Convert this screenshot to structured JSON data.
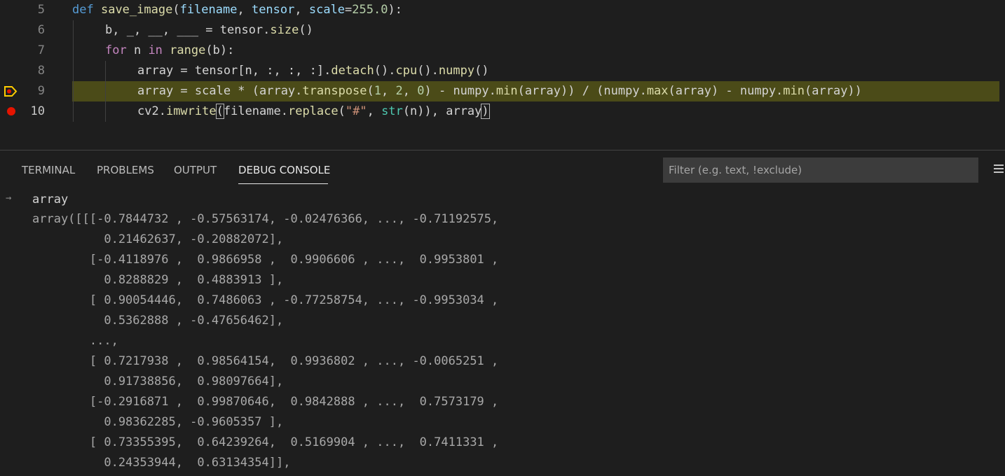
{
  "editor": {
    "lines": [
      {
        "number": "5"
      },
      {
        "number": "6"
      },
      {
        "number": "7"
      },
      {
        "number": "8"
      },
      {
        "number": "9"
      },
      {
        "number": "10"
      }
    ],
    "code": {
      "l5_def": "def",
      "l5_fn": "save_image",
      "l5_p1": "filename",
      "l5_p2": "tensor",
      "l5_p3": "scale",
      "l5_num": "255.0",
      "l6_text": "b, _, __, ___ = tensor.",
      "l6_fn": "size",
      "l7_for": "for",
      "l7_n": " n ",
      "l7_in": "in",
      "l7_range": "range",
      "l7_rest": "(b):",
      "l8_a": "array = tensor[n, :, :, :].",
      "l8_f1": "detach",
      "l8_f2": "cpu",
      "l8_f3": "numpy",
      "l9_a": "array = scale * (array.",
      "l9_f1": "transpose",
      "l9_n1": "1",
      "l9_n2": "2",
      "l9_n3": "0",
      "l9_b": ") - numpy.",
      "l9_f2": "min",
      "l9_c": "(array)) / (numpy.",
      "l9_f3": "max",
      "l9_d": "(array) - numpy.",
      "l9_f4": "min",
      "l9_e": "(array))",
      "l10_a": "cv2.",
      "l10_f1": "imwrite",
      "l10_b": "filename.",
      "l10_f2": "replace",
      "l10_str": "\"#\"",
      "l10_bi": "str",
      "l10_c": "(n)), array"
    }
  },
  "panel": {
    "tabs": [
      {
        "label": "TERMINAL"
      },
      {
        "label": "PROBLEMS"
      },
      {
        "label": "OUTPUT"
      },
      {
        "label": "DEBUG CONSOLE"
      }
    ],
    "active_tab": "DEBUG CONSOLE",
    "filter_placeholder": "Filter (e.g. text, !exclude)"
  },
  "console": {
    "input": "array",
    "output": [
      "array([[[-0.7844732 , -0.57563174, -0.02476366, ..., -0.71192575,",
      "          0.21462637, -0.20882072],",
      "        [-0.4118976 ,  0.9866958 ,  0.9906606 , ...,  0.9953801 ,",
      "          0.8288829 ,  0.4883913 ],",
      "        [ 0.90054446,  0.7486063 , -0.77258754, ..., -0.9953034 ,",
      "          0.5362888 , -0.47656462],",
      "        ...,",
      "        [ 0.7217938 ,  0.98564154,  0.9936802 , ..., -0.0065251 ,",
      "          0.91738856,  0.98097664],",
      "        [-0.2916871 ,  0.99870646,  0.9842888 , ...,  0.7573179 ,",
      "          0.98362285, -0.9605357 ],",
      "        [ 0.73355395,  0.64239264,  0.5169904 , ...,  0.7411331 ,",
      "          0.24353944,  0.63134354]],"
    ]
  },
  "colors": {
    "breakpoint": "#e51400",
    "current_line_highlight": "#4b4b18",
    "debug_arrow": "#ffcc00"
  }
}
